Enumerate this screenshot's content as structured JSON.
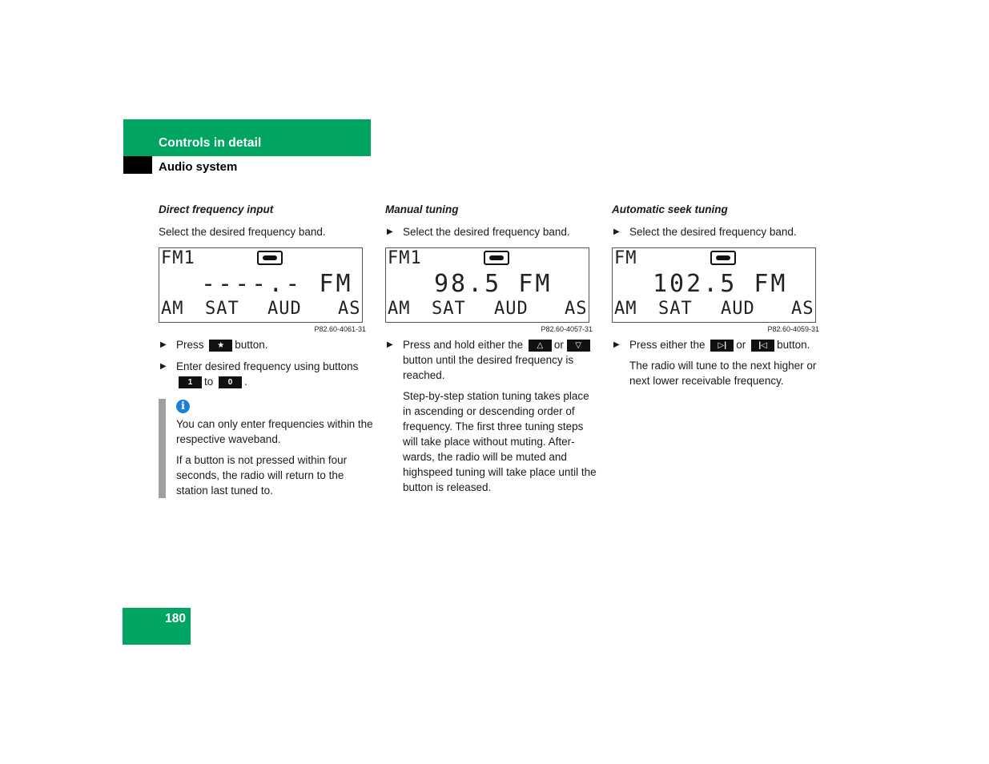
{
  "header": {
    "section": "Controls in detail",
    "subsection": "Audio system"
  },
  "colors": {
    "brand_green": "#00a562",
    "info_blue": "#1a7fd6",
    "note_bar": "#a0a0a0"
  },
  "columns": [
    {
      "title": "Direct frequency input",
      "intro": "Select the desired frequency band.",
      "display": {
        "band": "FM1",
        "icon": "cassette-icon",
        "frequency": "----.- FM",
        "softkeys": [
          "AM",
          "SAT",
          "AUD",
          "AS"
        ],
        "figure_code": "P82.60-4061-31"
      },
      "steps": [
        {
          "pre": "Press",
          "key1": "★",
          "mid": "",
          "key2": "",
          "post": "button."
        },
        {
          "pre": "Enter desired frequency using buttons",
          "key1": "1",
          "mid": "to",
          "key2": "0",
          "post": "."
        }
      ],
      "note": {
        "icon": "info-icon",
        "paragraphs": [
          "You can only enter frequencies within the respective waveband.",
          "If a button is not pressed within four seconds, the radio will return to the station last tuned to."
        ]
      }
    },
    {
      "title": "Manual tuning",
      "intro": "Select the desired frequency band.",
      "display": {
        "band": "FM1",
        "icon": "cassette-icon",
        "frequency": "98.5 FM",
        "softkeys": [
          "AM",
          "SAT",
          "AUD",
          "AS"
        ],
        "figure_code": "P82.60-4057-31"
      },
      "steps": [
        {
          "pre": "Press and hold either the",
          "key1": "△",
          "mid": "or",
          "key2": "▽",
          "post": "button until the desired frequency is reached."
        }
      ],
      "body": "Step-by-step station tuning takes place in ascending or descending order of frequency. The first three tuning steps will take place without muting. After-wards, the radio will be muted and highspeed tuning will take place until the button is released."
    },
    {
      "title": "Automatic seek tuning",
      "intro": "Select the desired frequency band.",
      "display": {
        "band": "FM",
        "icon": "cassette-icon",
        "frequency": "102.5 FM",
        "softkeys": [
          "AM",
          "SAT",
          "AUD",
          "AS"
        ],
        "figure_code": "P82.60-4059-31"
      },
      "steps": [
        {
          "pre": "Press either the",
          "key1": "▷|",
          "mid": "or",
          "key2": "|◁",
          "post": "button."
        }
      ],
      "body": "The radio will tune to the next higher or next lower receivable frequency."
    }
  ],
  "page_number": "180"
}
